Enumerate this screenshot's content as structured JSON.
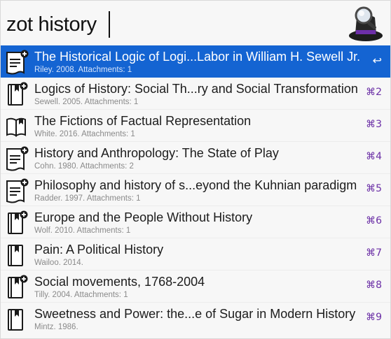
{
  "search": {
    "query": "zot history"
  },
  "app": {
    "icon": "alfred-hat-magnifier-icon"
  },
  "results": [
    {
      "title": "The Historical Logic of Logi...Labor in William H. Sewell Jr.",
      "subtitle": "Riley. 2008. Attachments: 1",
      "shortcut": "↩",
      "icon": "journal-article-icon",
      "selected": true
    },
    {
      "title": "Logics of History: Social Th...ry and Social Transformation",
      "subtitle": "Sewell. 2005. Attachments: 1",
      "shortcut": "⌘2",
      "icon": "book-icon"
    },
    {
      "title": "The Fictions of Factual Representation",
      "subtitle": "White. 2016. Attachments: 1",
      "shortcut": "⌘3",
      "icon": "book-section-icon"
    },
    {
      "title": "History and Anthropology: The State of Play",
      "subtitle": "Cohn. 1980. Attachments: 2",
      "shortcut": "⌘4",
      "icon": "journal-article-icon"
    },
    {
      "title": "Philosophy and history of s...eyond the Kuhnian paradigm",
      "subtitle": "Radder. 1997. Attachments: 1",
      "shortcut": "⌘5",
      "icon": "journal-article-icon"
    },
    {
      "title": "Europe and the People Without History",
      "subtitle": "Wolf. 2010. Attachments: 1",
      "shortcut": "⌘6",
      "icon": "book-icon"
    },
    {
      "title": "Pain: A Political History",
      "subtitle": "Wailoo. 2014.",
      "shortcut": "⌘7",
      "icon": "book-icon"
    },
    {
      "title": "Social movements, 1768-2004",
      "subtitle": "Tilly. 2004. Attachments: 1",
      "shortcut": "⌘8",
      "icon": "book-icon"
    },
    {
      "title": "Sweetness and Power: the...e of Sugar in Modern History",
      "subtitle": "Mintz. 1986.",
      "shortcut": "⌘9",
      "icon": "book-icon"
    }
  ]
}
